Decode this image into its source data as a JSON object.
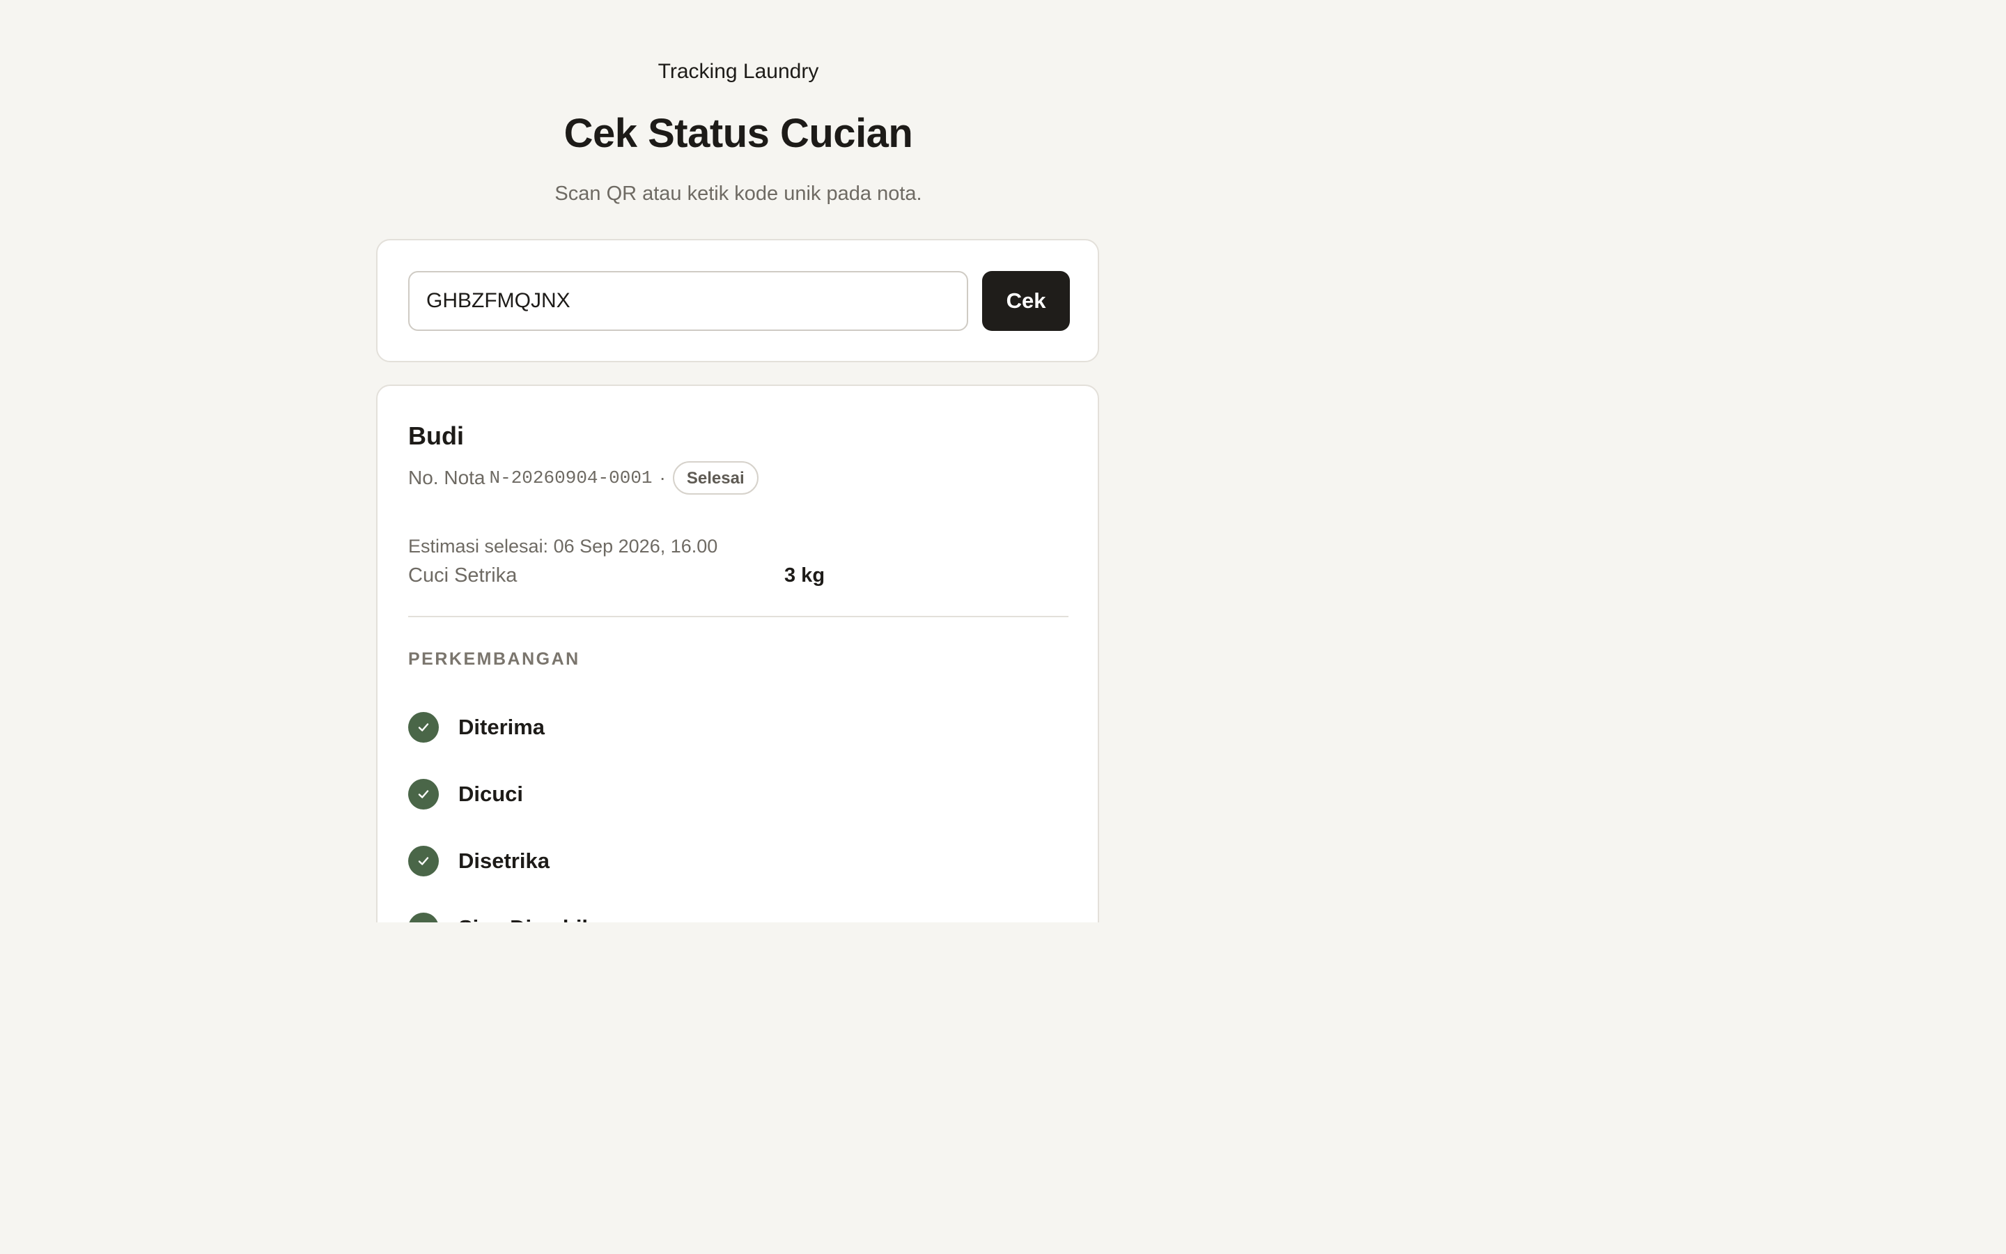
{
  "header": {
    "eyebrow": "Tracking Laundry",
    "title": "Cek Status Cucian",
    "subtitle": "Scan QR atau ketik kode unik pada nota."
  },
  "search": {
    "value": "GHBZFMQJNX",
    "button_label": "Cek"
  },
  "order": {
    "customer_name": "Budi",
    "nota_label": "No. Nota",
    "nota_number": "N-20260904-0001",
    "separator": "·",
    "status": "Selesai",
    "estimate": "Estimasi selesai: 06 Sep 2026, 16.00",
    "service": "Cuci Setrika",
    "weight": "3 kg"
  },
  "progress": {
    "section_label": "PERKEMBANGAN",
    "steps": [
      {
        "label": "Diterima",
        "done": true
      },
      {
        "label": "Dicuci",
        "done": true
      },
      {
        "label": "Disetrika",
        "done": true
      },
      {
        "label": "Siap Diambil",
        "done": true
      }
    ]
  },
  "colors": {
    "background": "#f6f5f1",
    "primary_button": "#1f1d1a",
    "step_done": "#4a6648"
  }
}
